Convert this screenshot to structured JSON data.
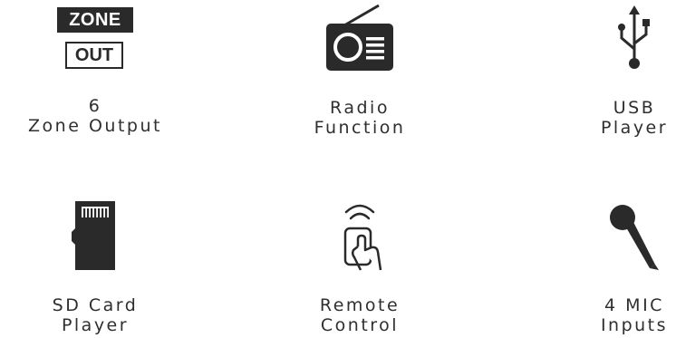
{
  "features": [
    {
      "line1": "6",
      "line2": "Zone Output",
      "icon": "zone-out-icon",
      "badge_top": "ZONE",
      "badge_bottom": "OUT"
    },
    {
      "line1": "Radio",
      "line2": "Function",
      "icon": "radio-icon"
    },
    {
      "line1": "USB",
      "line2": "Player",
      "icon": "usb-icon"
    },
    {
      "line1": "SD Card",
      "line2": "Player",
      "icon": "sd-card-icon"
    },
    {
      "line1": "Remote",
      "line2": "Control",
      "icon": "remote-control-icon"
    },
    {
      "line1": "4 MIC",
      "line2": "Inputs",
      "icon": "microphone-icon"
    }
  ],
  "colors": {
    "icon": "#2a2a2a",
    "text": "#2f2f2f",
    "background": "#ffffff"
  }
}
